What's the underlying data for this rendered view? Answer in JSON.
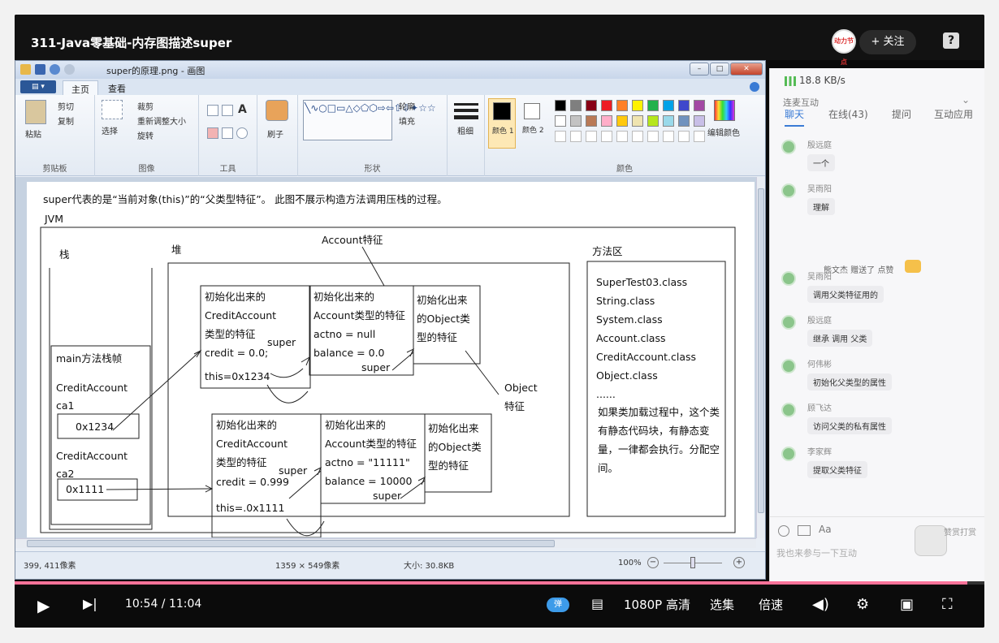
{
  "video": {
    "title": "311-Java零基础-内存图描述super",
    "follow_label": "+ 关注",
    "channel_logo_text": "动力节点",
    "help_label": "?"
  },
  "paint": {
    "title": "super的原理.png - 画图",
    "file_tab": "▤ ▾",
    "tabs": [
      "主页",
      "查看"
    ],
    "clipboard": {
      "paste": "粘贴",
      "cut": "剪切",
      "copy": "复制",
      "label": "剪贴板"
    },
    "image": {
      "select": "选择",
      "crop": "裁剪",
      "resize": "重新调整大小",
      "rotate": "旋转",
      "label": "图像"
    },
    "tools": {
      "label": "工具"
    },
    "brushes": {
      "label": "刷子"
    },
    "shapes": {
      "outline": "轮廓",
      "fill": "填充",
      "label": "形状"
    },
    "size": {
      "label": "粗细"
    },
    "colors": {
      "color1": "颜色 1",
      "color2": "颜色 2",
      "edit": "编辑颜色",
      "label": "颜色",
      "palette": [
        "#000000",
        "#7f7f7f",
        "#880015",
        "#ed1c24",
        "#ff7f27",
        "#fff200",
        "#22b14c",
        "#00a2e8",
        "#3f48cc",
        "#a349a4",
        "#ffffff",
        "#c3c3c3",
        "#b97a57",
        "#ffaec9",
        "#ffc90e",
        "#efe4b0",
        "#b5e61d",
        "#99d9ea",
        "#7092be",
        "#c8bfe7"
      ]
    },
    "status": {
      "position": "399, 411像素",
      "selection": "1359 × 549像素",
      "filesize": "大小: 30.8KB",
      "zoom": "100%"
    }
  },
  "diagram": {
    "heading": "super代表的是“当前对象(this)”的“父类型特征”。       此图不展示构造方法调用压栈的过程。",
    "jvm": "JVM",
    "stack": "栈",
    "heap": "堆",
    "method_area": "方法区",
    "account_feature": "Account特征",
    "object_feature": "Object\n特征",
    "main_frame": "main方法栈帧",
    "var1_type": "CreditAccount",
    "var1_name": "ca1",
    "var1_value": "0x1234",
    "var2_type": "CreditAccount",
    "var2_name": "ca2",
    "var2_value": "0x1111",
    "obj1_credit": [
      "初始化出来的",
      "CreditAccount",
      "类型的特征",
      "credit = 0.0;",
      "this=0x1234"
    ],
    "obj1_account": [
      "初始化出来的",
      "Account类型的特征",
      "actno = null",
      "balance = 0.0"
    ],
    "obj1_object": [
      "初始化出来",
      "的Object类",
      "型的特征"
    ],
    "obj2_credit": [
      "初始化出来的",
      "CreditAccount",
      "类型的特征",
      "credit = 0.999",
      "this=.0x1111"
    ],
    "obj2_account": [
      "初始化出来的",
      "Account类型的特征",
      "actno = \"11111\"",
      "balance = 10000"
    ],
    "obj2_object": [
      "初始化出来",
      "的Object类",
      "型的特征"
    ],
    "super": "super",
    "classes": [
      "SuperTest03.class",
      "String.class",
      "System.class",
      "Account.class",
      "CreditAccount.class",
      "Object.class",
      "......"
    ],
    "note": [
      "如果类加载过程中，这个类",
      "有静态代码块，有静态变",
      "量，一律都会执行。分配空",
      "间。"
    ]
  },
  "chat": {
    "net_speed": "18.8 KB/s",
    "subheader": "连麦互动",
    "tabs": [
      "聊天",
      "在线(43)",
      "提问",
      "互动应用"
    ],
    "gift": "熊文杰 赠送了 点赞",
    "messages": [
      {
        "name": "殷远庭",
        "text": "一个"
      },
      {
        "name": "吴雨阳",
        "text": "理解"
      },
      {
        "name": "吴雨阳",
        "text": "调用父类特征用的"
      },
      {
        "name": "殷远庭",
        "text": "继承 调用 父类"
      },
      {
        "name": "何伟彬",
        "text": "初始化父类型的属性"
      },
      {
        "name": "顾飞达",
        "text": "访问父类的私有属性"
      },
      {
        "name": "李家辉",
        "text": "提取父类特征"
      }
    ],
    "input_placeholder": "我也来参与一下互动",
    "reward": "赞赏打赏"
  },
  "controls": {
    "time": "10:54 / 11:04",
    "progress": 0.982,
    "danmu": "弹",
    "quality": "1080P 高清",
    "episodes": "选集",
    "speed": "倍速"
  }
}
